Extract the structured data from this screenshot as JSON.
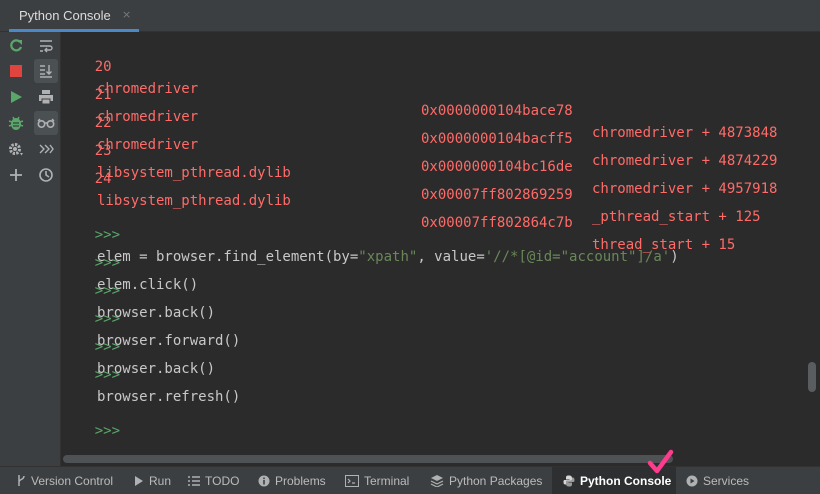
{
  "tab": {
    "title": "Python Console",
    "close": "×"
  },
  "left_toolbar": [
    "rerun-icon",
    "stop-icon",
    "run-icon",
    "debug-icon",
    "settings-icon",
    "add-icon"
  ],
  "right_toolbar": [
    "soft-wrap-icon",
    "scroll-to-end-icon",
    "print-icon",
    "show-variables-icon",
    "execute-history-icon",
    "history-icon"
  ],
  "traceback": [
    {
      "num": "20",
      "lib": "chromedriver",
      "addr": "0x0000000104bace78",
      "sym": "chromedriver + 4873848"
    },
    {
      "num": "21",
      "lib": "chromedriver",
      "addr": "0x0000000104bacff5",
      "sym": "chromedriver + 4874229"
    },
    {
      "num": "22",
      "lib": "chromedriver",
      "addr": "0x0000000104bc16de",
      "sym": "chromedriver + 4957918"
    },
    {
      "num": "23",
      "lib": "libsystem_pthread.dylib",
      "addr": "0x00007ff802869259",
      "sym": "_pthread_start + 125"
    },
    {
      "num": "24",
      "lib": "libsystem_pthread.dylib",
      "addr": "0x00007ff802864c7b",
      "sym": "thread_start + 15"
    }
  ],
  "prompt": ">>>",
  "cmd1": {
    "a": "elem = browser.find_element(by=",
    "s1": "\"xpath\"",
    "b": ", value=",
    "s2": "'//*[@id=\"account\"]/a'",
    "c": ")"
  },
  "commands": [
    "elem.click()",
    "browser.back()",
    "browser.forward()",
    "browser.back()",
    "browser.refresh()"
  ],
  "statusbar": [
    {
      "label": "Version Control",
      "icon": "branch-icon"
    },
    {
      "label": "Run",
      "icon": "play-icon"
    },
    {
      "label": "TODO",
      "icon": "list-icon"
    },
    {
      "label": "Problems",
      "icon": "info-icon"
    },
    {
      "label": "Terminal",
      "icon": "terminal-icon"
    },
    {
      "label": "Python Packages",
      "icon": "layers-icon"
    },
    {
      "label": "Python Console",
      "icon": "python-icon",
      "active": true
    },
    {
      "label": "Services",
      "icon": "services-icon"
    }
  ],
  "colors": {
    "accent": "#4a88c7",
    "error": "#ff6b68",
    "prompt": "#59a869",
    "string": "#6a8759",
    "checkmark": "#ff3b8d"
  }
}
